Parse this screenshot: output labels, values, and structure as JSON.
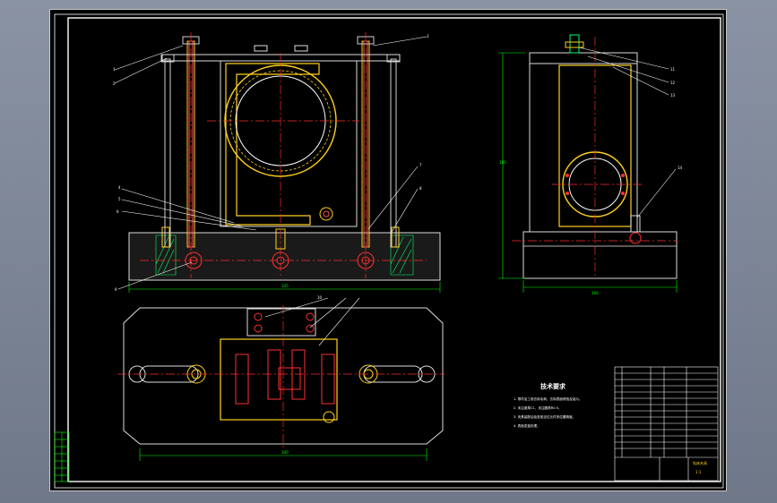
{
  "drawing": {
    "technical_requirements_title": "技术要求",
    "technical_requirements": [
      "1. 零件加工前去除毛刺，去除表面锈蚀及油污。",
      "2. 未注倒角C1，未注圆角R0.5。",
      "3. 夹具装配后检查各定位元件的位置精度。",
      "4. 表面发蓝处理。"
    ],
    "balloons": [
      "1",
      "2",
      "3",
      "4",
      "5",
      "6",
      "7",
      "8",
      "9",
      "10",
      "11",
      "12",
      "13",
      "14"
    ],
    "title_block_name": "钻床夹具",
    "title_block_scale": "1:1"
  },
  "colors": {
    "frame": "#ffffff",
    "part_outline": "#e8e8e8",
    "centerline": "#ff2a2a",
    "section": "#ffd11a",
    "hatch": "#00ff66",
    "dimension": "#00ff00",
    "highlight": "#ff3030",
    "fixture_plate": "#b0b4b8"
  }
}
